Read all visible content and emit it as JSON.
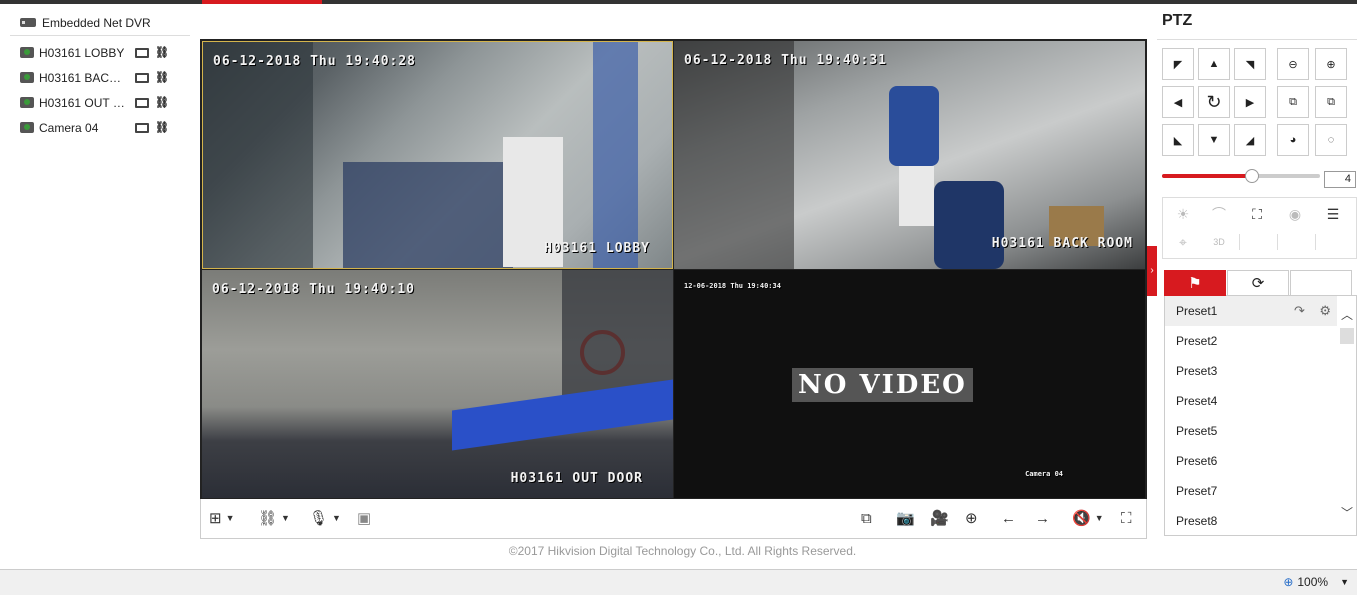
{
  "tree": {
    "root_label": "Embedded Net DVR",
    "cameras": [
      {
        "label": "H03161 LOBBY"
      },
      {
        "label": "H03161 BACK ROOM"
      },
      {
        "label": "H03161 OUT DOOR"
      },
      {
        "label": "Camera 04"
      }
    ]
  },
  "video": {
    "tiles": [
      {
        "timestamp": "06-12-2018 Thu 19:40:28",
        "name": "H03161 LOBBY"
      },
      {
        "timestamp": "06-12-2018 Thu 19:40:31",
        "name": "H03161 BACK ROOM"
      },
      {
        "timestamp": "06-12-2018 Thu 19:40:10",
        "name": "H03161 OUT DOOR"
      },
      {
        "timestamp": "12-06-2018 Thu 19:40:34",
        "name": "Camera 04",
        "overlay": "NO VIDEO"
      }
    ]
  },
  "footer": {
    "copyright": "©2017 Hikvision Digital Technology Co., Ltd. All Rights Reserved."
  },
  "statusbar": {
    "zoom": "100%"
  },
  "ptz": {
    "title": "PTZ",
    "speed_fraction": 0.57,
    "speed_value": "4",
    "presets": [
      "Preset1",
      "Preset2",
      "Preset3",
      "Preset4",
      "Preset5",
      "Preset6",
      "Preset7",
      "Preset8"
    ]
  },
  "colors": {
    "accent": "#d71a1f"
  }
}
